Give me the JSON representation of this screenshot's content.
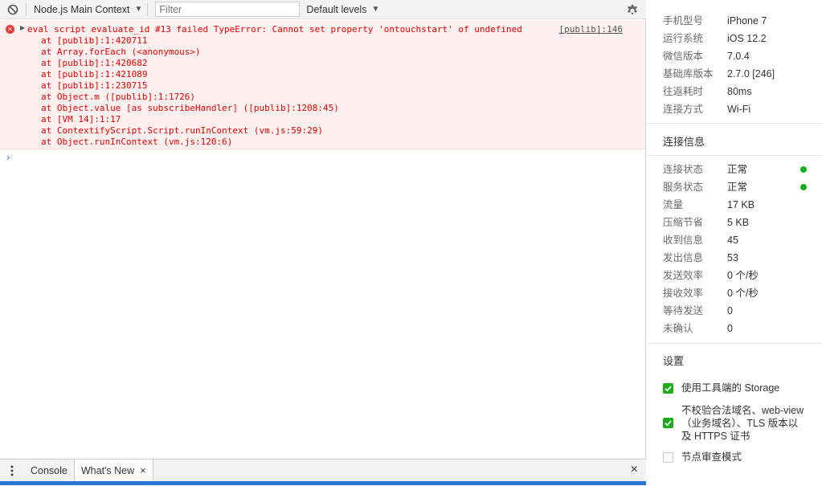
{
  "toolbar": {
    "context_label": "Node.js Main Context",
    "filter_placeholder": "Filter",
    "levels_label": "Default levels"
  },
  "error": {
    "message": "eval script evaluate_id #13 failed TypeError: Cannot set property 'ontouchstart' of undefined",
    "source": "[publib]:146",
    "stack": [
      "at [publib]:1:420711",
      "at Array.forEach (<anonymous>)",
      "at [publib]:1:420682",
      "at [publib]:1:421089",
      "at [publib]:1:230715",
      "at Object.m ([publib]:1:1726)",
      "at Object.value [as subscribeHandler] ([publib]:1208:45)",
      "at [VM 14]:1:17",
      "at ContextifyScript.Script.runInContext (vm.js:59:29)",
      "at Object.runInContext (vm.js:120:6)"
    ]
  },
  "prompt_symbol": "›",
  "drawer": {
    "tabs": [
      {
        "label": "Console"
      },
      {
        "label": "What's New"
      }
    ],
    "tab_close": "×",
    "close": "×"
  },
  "device_info": [
    {
      "key": "手机型号",
      "value": "iPhone 7"
    },
    {
      "key": "运行系统",
      "value": "iOS 12.2"
    },
    {
      "key": "微信版本",
      "value": "7.0.4"
    },
    {
      "key": "基础库版本",
      "value": "2.7.0 [246]"
    },
    {
      "key": "往返耗时",
      "value": "80ms"
    },
    {
      "key": "连接方式",
      "value": "Wi-Fi"
    }
  ],
  "connection": {
    "title": "连接信息",
    "rows": [
      {
        "key": "连接状态",
        "value": "正常",
        "status": "ok"
      },
      {
        "key": "服务状态",
        "value": "正常",
        "status": "ok"
      },
      {
        "key": "流量",
        "value": "17 KB"
      },
      {
        "key": "压缩节省",
        "value": "5 KB"
      },
      {
        "key": "收到信息",
        "value": "45"
      },
      {
        "key": "发出信息",
        "value": "53"
      },
      {
        "key": "发送效率",
        "value": "0 个/秒"
      },
      {
        "key": "接收效率",
        "value": "0 个/秒"
      },
      {
        "key": "等待发送",
        "value": "0"
      },
      {
        "key": "未确认",
        "value": "0"
      }
    ]
  },
  "settings": {
    "title": "设置",
    "options": [
      {
        "label": "使用工具端的 Storage",
        "checked": true
      },
      {
        "label": "不校验合法域名、web-view（业务域名）、TLS 版本以及 HTTPS 证书",
        "checked": true
      },
      {
        "label": "节点审查模式",
        "checked": false
      }
    ]
  },
  "colors": {
    "status_ok": "#1aad19",
    "error_text": "#e00000",
    "error_bg": "#fff0f0",
    "accent": "#2a73d9"
  }
}
